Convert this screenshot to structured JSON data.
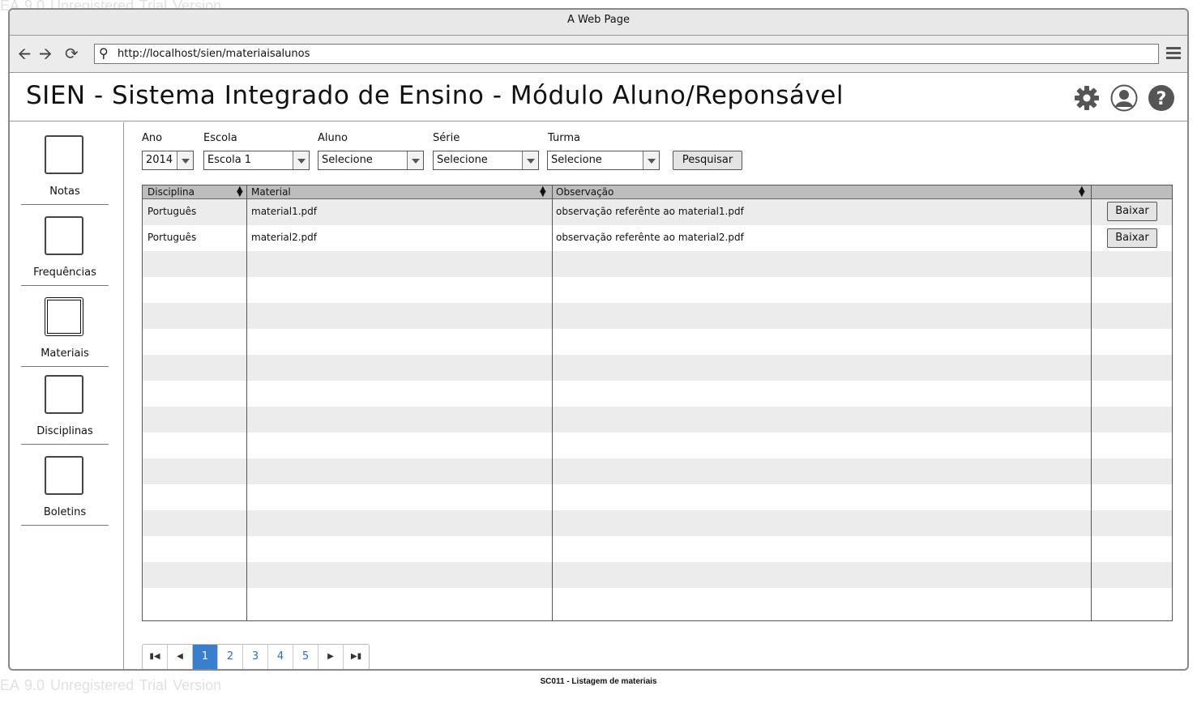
{
  "watermark": "EA 9.0 Unregistered Trial Version",
  "window": {
    "title": "A Web Page"
  },
  "browser": {
    "url": "http://localhost/sien/materiaisalunos"
  },
  "header": {
    "title": "SIEN - Sistema Integrado de Ensino - Módulo Aluno/Reponsável"
  },
  "sidebar": {
    "items": [
      {
        "label": "Notas"
      },
      {
        "label": "Frequências"
      },
      {
        "label": "Materiais",
        "active": true
      },
      {
        "label": "Disciplinas"
      },
      {
        "label": "Boletins"
      }
    ]
  },
  "filters": {
    "ano": {
      "label": "Ano",
      "value": "2014"
    },
    "escola": {
      "label": "Escola",
      "value": "Escola 1"
    },
    "aluno": {
      "label": "Aluno",
      "value": "Selecione"
    },
    "serie": {
      "label": "Série",
      "value": "Selecione"
    },
    "turma": {
      "label": "Turma",
      "value": "Selecione"
    },
    "search_label": "Pesquisar"
  },
  "table": {
    "columns": [
      "Disciplina",
      "Material",
      "Observação"
    ],
    "download_label": "Baixar",
    "rows": [
      {
        "disciplina": "Português",
        "material": "material1.pdf",
        "observacao": "observação referênte ao material1.pdf"
      },
      {
        "disciplina": "Português",
        "material": "material2.pdf",
        "observacao": "observação referênte ao material2.pdf"
      }
    ]
  },
  "pagination": {
    "pages": [
      "1",
      "2",
      "3",
      "4",
      "5"
    ],
    "current": "1"
  },
  "caption": "SC011 - Listagem de materiais"
}
